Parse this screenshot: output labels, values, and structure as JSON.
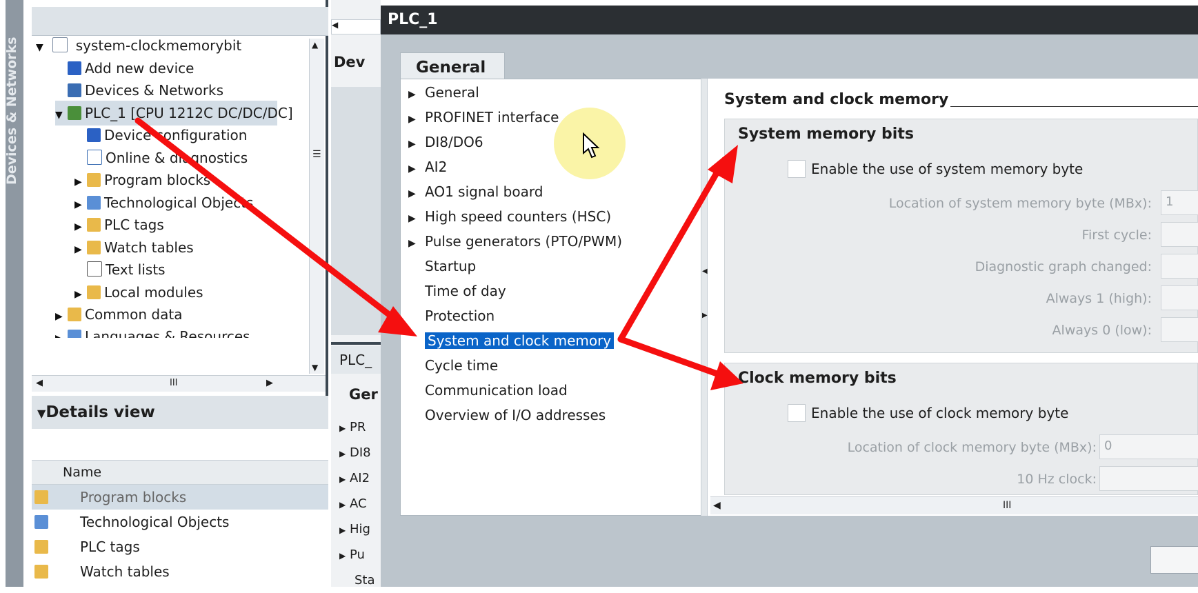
{
  "side_tab": {
    "label": "Devices & Networks"
  },
  "project_tree": {
    "root": "system-clockmemorybit",
    "items": [
      {
        "label": "Add new device"
      },
      {
        "label": "Devices & Networks"
      },
      {
        "label": "PLC_1 [CPU 1212C DC/DC/DC]"
      },
      {
        "label": "Device configuration"
      },
      {
        "label": "Online & diagnostics"
      },
      {
        "label": "Program blocks"
      },
      {
        "label": "Technological Objects"
      },
      {
        "label": "PLC tags"
      },
      {
        "label": "Watch tables"
      },
      {
        "label": "Text lists"
      },
      {
        "label": "Local modules"
      },
      {
        "label": "Common data"
      },
      {
        "label": "Languages & Resources"
      }
    ]
  },
  "details": {
    "title": "Details view",
    "column_name": "Name",
    "rows": [
      "Program blocks",
      "Technological Objects",
      "PLC tags",
      "Watch tables"
    ]
  },
  "middle_strip": {
    "header_1": "Dev",
    "header_2": "PLC_",
    "header_3": "Ger",
    "items": [
      "PR",
      "DI8",
      "AI2",
      "AC",
      "Hig",
      "Pu",
      "Sta"
    ]
  },
  "dialog": {
    "title": "PLC_1",
    "tab": "General",
    "nav_items": [
      {
        "label": "General",
        "expandable": true
      },
      {
        "label": "PROFINET interface",
        "expandable": true
      },
      {
        "label": "DI8/DO6",
        "expandable": true
      },
      {
        "label": "AI2",
        "expandable": true
      },
      {
        "label": "AO1 signal board",
        "expandable": true
      },
      {
        "label": "High speed counters (HSC)",
        "expandable": true
      },
      {
        "label": "Pulse generators (PTO/PWM)",
        "expandable": true
      },
      {
        "label": "Startup",
        "expandable": false
      },
      {
        "label": "Time of day",
        "expandable": false
      },
      {
        "label": "Protection",
        "expandable": false
      },
      {
        "label": "System and clock memory",
        "expandable": false,
        "selected": true
      },
      {
        "label": "Cycle time",
        "expandable": false
      },
      {
        "label": "Communication load",
        "expandable": false
      },
      {
        "label": "Overview of I/O addresses",
        "expandable": false
      }
    ],
    "section_title": "System and clock memory",
    "system_group": {
      "title": "System memory bits",
      "checkbox_label": "Enable the use of system memory byte",
      "fields": [
        {
          "label": "Location of system memory byte (MBx):",
          "value": "1"
        },
        {
          "label": "First cycle:",
          "value": ""
        },
        {
          "label": "Diagnostic graph changed:",
          "value": ""
        },
        {
          "label": "Always 1 (high):",
          "value": ""
        },
        {
          "label": "Always 0 (low):",
          "value": ""
        }
      ]
    },
    "clock_group": {
      "title": "Clock memory bits",
      "checkbox_label": "Enable the use of clock memory byte",
      "fields": [
        {
          "label": "Location of clock memory byte (MBx):",
          "value": "0"
        },
        {
          "label": "10 Hz clock:",
          "value": ""
        }
      ]
    }
  },
  "annotation_color": "#f50f0f"
}
